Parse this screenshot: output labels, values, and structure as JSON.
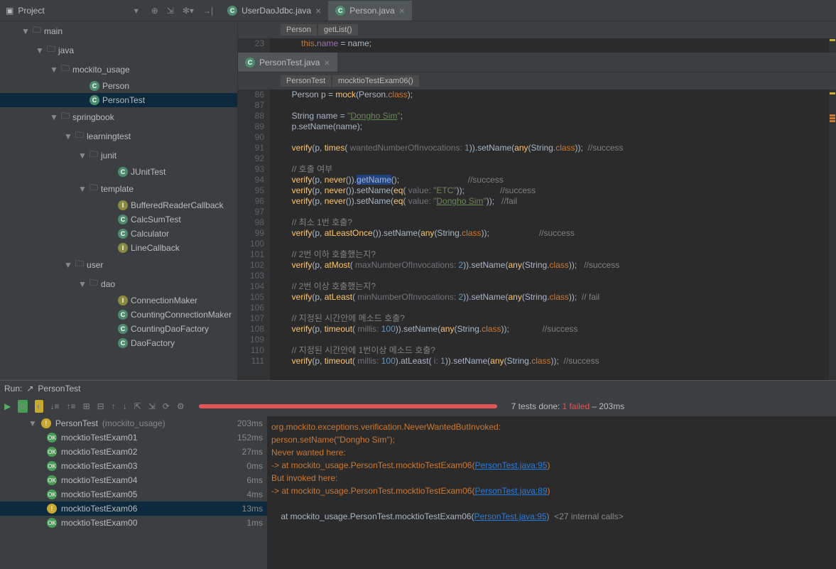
{
  "toolbar": {
    "project_label": "Project"
  },
  "editor_tabs": [
    {
      "label": "UserDaoJdbc.java",
      "active": false
    },
    {
      "label": "Person.java",
      "active": true
    }
  ],
  "sub_tabs": [
    {
      "label": "PersonTest.java",
      "active": true
    }
  ],
  "breadcrumb_top": [
    "Person",
    "getList()"
  ],
  "breadcrumb_main": [
    "PersonTest",
    "mocktioTestExam06()"
  ],
  "tree": [
    {
      "indent": 30,
      "type": "folder",
      "label": "main",
      "arrow": "▼"
    },
    {
      "indent": 50,
      "type": "folder",
      "label": "java",
      "arrow": "▼"
    },
    {
      "indent": 70,
      "type": "package",
      "label": "mockito_usage",
      "arrow": "▼"
    },
    {
      "indent": 110,
      "type": "class",
      "label": "Person"
    },
    {
      "indent": 110,
      "type": "class",
      "label": "PersonTest",
      "selected": true
    },
    {
      "indent": 70,
      "type": "package",
      "label": "springbook",
      "arrow": "▼"
    },
    {
      "indent": 90,
      "type": "package",
      "label": "learningtest",
      "arrow": "▼"
    },
    {
      "indent": 110,
      "type": "package",
      "label": "junit",
      "arrow": "▼"
    },
    {
      "indent": 150,
      "type": "class",
      "label": "JUnitTest"
    },
    {
      "indent": 110,
      "type": "package",
      "label": "template",
      "arrow": "▼"
    },
    {
      "indent": 150,
      "type": "interface",
      "label": "BufferedReaderCallback"
    },
    {
      "indent": 150,
      "type": "class",
      "label": "CalcSumTest"
    },
    {
      "indent": 150,
      "type": "class",
      "label": "Calculator"
    },
    {
      "indent": 150,
      "type": "interface",
      "label": "LineCallback"
    },
    {
      "indent": 90,
      "type": "package",
      "label": "user",
      "arrow": "▼"
    },
    {
      "indent": 110,
      "type": "package",
      "label": "dao",
      "arrow": "▼"
    },
    {
      "indent": 150,
      "type": "interface",
      "label": "ConnectionMaker"
    },
    {
      "indent": 150,
      "type": "class",
      "label": "CountingConnectionMaker"
    },
    {
      "indent": 150,
      "type": "class",
      "label": "CountingDaoFactory"
    },
    {
      "indent": 150,
      "type": "class",
      "label": "DaoFactory"
    }
  ],
  "top_code": {
    "line_start": 23,
    "text": "            this.name = name;"
  },
  "code": {
    "lines": [
      86,
      87,
      88,
      89,
      90,
      91,
      92,
      93,
      94,
      95,
      96,
      97,
      98,
      99,
      100,
      101,
      102,
      103,
      104,
      105,
      106,
      107,
      108,
      109,
      110,
      111
    ]
  },
  "run": {
    "label": "Run:",
    "config": "PersonTest",
    "summary_prefix": "7 tests done:",
    "summary_failed": "1 failed",
    "summary_time": "– 203ms",
    "suite": "PersonTest",
    "suite_pkg": "(mockito_usage)",
    "suite_time": "203ms",
    "tests": [
      {
        "name": "mocktioTestExam01",
        "time": "152ms",
        "status": "ok"
      },
      {
        "name": "mocktioTestExam02",
        "time": "27ms",
        "status": "ok"
      },
      {
        "name": "mocktioTestExam03",
        "time": "0ms",
        "status": "ok"
      },
      {
        "name": "mocktioTestExam04",
        "time": "6ms",
        "status": "ok"
      },
      {
        "name": "mocktioTestExam05",
        "time": "4ms",
        "status": "ok"
      },
      {
        "name": "mocktioTestExam06",
        "time": "13ms",
        "status": "warn",
        "selected": true
      },
      {
        "name": "mocktioTestExam00",
        "time": "1ms",
        "status": "ok"
      }
    ]
  },
  "console": {
    "l1": "org.mockito.exceptions.verification.NeverWantedButInvoked:",
    "l2": "person.setName(\"Dongho Sim\");",
    "l3": "Never wanted here:",
    "l4a": "-> at mockito_usage.PersonTest.mocktioTestExam06(",
    "l4b": "PersonTest.java:95",
    "l5": "But invoked here:",
    "l6a": "-> at mockito_usage.PersonTest.mocktioTestExam06(",
    "l6b": "PersonTest.java:89",
    "l7a": "    at mockito_usage.PersonTest.mocktioTestExam06(",
    "l7b": "PersonTest.java:95",
    "l7c": ")  <27 internal calls>"
  }
}
